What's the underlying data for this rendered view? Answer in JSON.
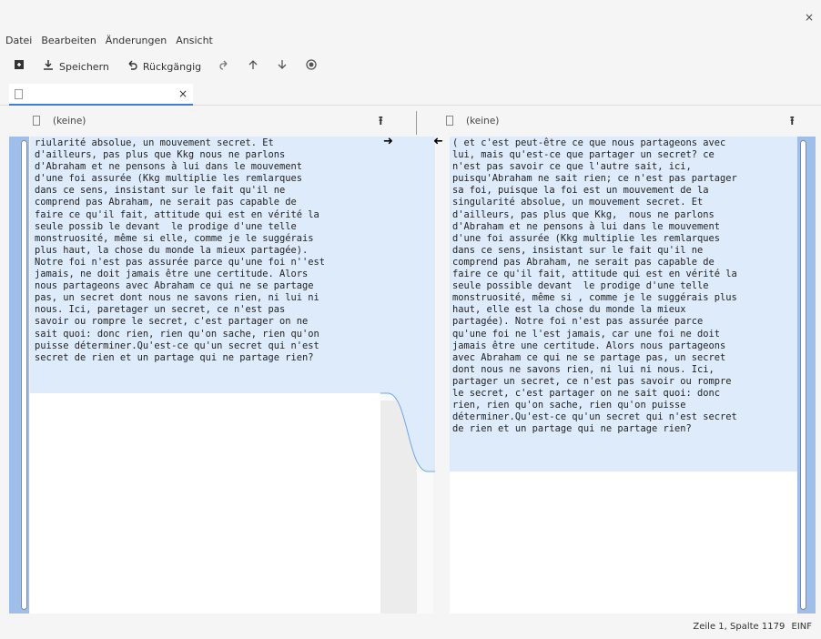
{
  "window": {
    "close_label": "×"
  },
  "menu": [
    "Datei",
    "Bearbeiten",
    "Änderungen",
    "Ansicht"
  ],
  "toolbar": {
    "new_icon": "new-file-icon",
    "save_label": "Speichern",
    "undo_label": "Rückgängig",
    "redo_icon": "redo-icon",
    "up_icon": "arrow-up-icon",
    "down_icon": "arrow-down-icon",
    "record_icon": "record-icon"
  },
  "tab": {
    "title": "",
    "close_label": "×"
  },
  "left": {
    "file_label": "(keine)",
    "lines": [
      "riularité absolue, un mouvement secret. Et",
      "d'ailleurs, pas plus que Kkg nous ne parlons",
      "d'Abraham et ne pensons à lui dans le mouvement",
      "d'une foi assurée (Kkg multiplie les remlarques",
      "dans ce sens, insistant sur le fait qu'il ne",
      "comprend pas Abraham, ne serait pas capable de",
      "faire ce qu'il fait, attitude qui est en vérité la",
      "seule possib le devant  le prodige d'une telle",
      "monstruosité, même si elle, comme je le suggérais",
      "plus haut, la chose du monde la mieux partagée).",
      "Notre foi n'est pas assurée parce qu'une foi n''est",
      "jamais, ne doit jamais être une certitude. Alors",
      "nous partageons avec Abraham ce qui ne se partage",
      "pas, un secret dont nous ne savons rien, ni lui ni",
      "nous. Ici, paretager un secret, ce n'est pas",
      "savoir ou rompre le secret, c'est partager on ne",
      "sait quoi: donc rien, rien qu'on sache, rien qu'on",
      "puisse déterminer.Qu'est-ce qu'un secret qui n'est",
      "secret de rien et un partage qui ne partage rien?"
    ]
  },
  "right": {
    "file_label": "(keine)",
    "lines": [
      "( et c'est peut-être ce que nous partageons avec",
      "lui, mais qu'est-ce que partager un secret? ce",
      "n'est pas savoir ce que l'autre sait, ici,",
      "puisqu'Abraham ne sait rien; ce n'est pas partager",
      "sa foi, puisque la foi est un mouvement de la",
      "singularité absolue, un mouvement secret. Et",
      "d'ailleurs, pas plus que Kkg,  nous ne parlons",
      "d'Abraham et ne pensons à lui dans le mouvement",
      "d'une foi assurée (Kkg multiplie les remlarques",
      "dans ce sens, insistant sur le fait qu'il ne",
      "comprend pas Abraham, ne serait pas capable de",
      "faire ce qu'il fait, attitude qui est en vérité la",
      "seule possible devant  le prodige d'une telle",
      "monstruosité, même si , comme je le suggérais plus",
      "haut, elle est la chose du monde la mieux",
      "partagée). Notre foi n'est pas assurée parce",
      "qu'une foi ne l'est jamais, car une foi ne doit",
      "jamais être une certitude. Alors nous partageons",
      "avec Abraham ce qui ne se partage pas, un secret",
      "dont nous ne savons rien, ni lui ni nous. Ici,",
      "partager un secret, ce n'est pas savoir ou rompre",
      "le secret, c'est partager on ne sait quoi: donc",
      "rien, rien qu'on sache, rien qu'on puisse",
      "déterminer.Qu'est-ce qu'un secret qui n'est secret",
      "de rien et un partage qui ne partage rien?"
    ]
  },
  "colors": {
    "accent": "#3b7fd6",
    "change_bg": "#ddebfb",
    "change_hl": "#a9c9f1",
    "scroll": "#9fbfea"
  },
  "status": {
    "position": "Zeile 1, Spalte 1179",
    "mode": "EINF"
  }
}
